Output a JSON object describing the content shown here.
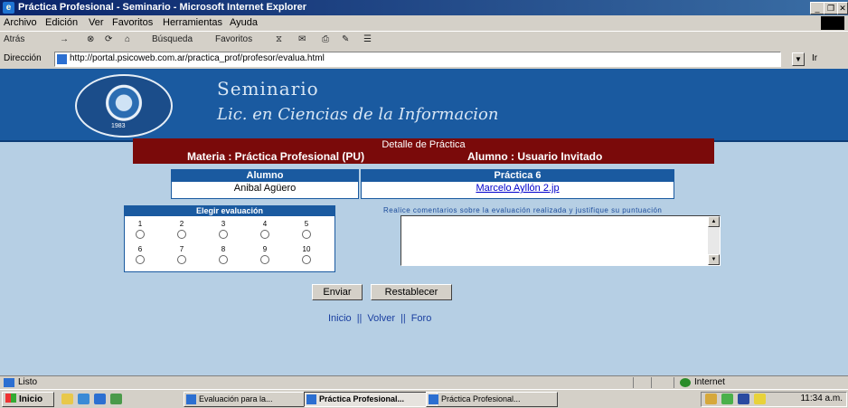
{
  "window": {
    "title": "Práctica Profesional - Seminario - Microsoft Internet Explorer",
    "buttons": [
      "_",
      "❐",
      "✕"
    ]
  },
  "menu": [
    "Archivo",
    "Edición",
    "Ver",
    "Favoritos",
    "Herramientas",
    "Ayuda"
  ],
  "toolbar": {
    "back": "Atrás",
    "forward": "→",
    "stop": "⊗",
    "refresh": "⟳",
    "home": "⌂",
    "search": "Búsqueda",
    "favorites": "Favoritos",
    "history": "⧖",
    "mail": "✉",
    "print": "⎙",
    "edit": "✎",
    "discuss": "☰"
  },
  "address": {
    "label": "Dirección",
    "url": "http://portal.psicoweb.com.ar/practica_prof/profesor/evalua.html",
    "go": "Ir"
  },
  "banner": {
    "line1": "Seminario",
    "line2": "Lic. en Ciencias de la Informacion",
    "seal_text": "1983"
  },
  "header": {
    "title": "Detalle de Práctica",
    "materia": "Materia : Práctica Profesional (PU)",
    "alumno": "Alumno : Usuario Invitado"
  },
  "info": {
    "alumno_header": "Alumno",
    "alumno_value": "Anibal Agüero",
    "practica_header": "Práctica 6",
    "practica_value": "Marcelo Ayllón 2.jp"
  },
  "evaluation": {
    "header": "Elegir evaluación",
    "options": [
      "1",
      "2",
      "3",
      "4",
      "5",
      "6",
      "7",
      "8",
      "9",
      "10"
    ]
  },
  "comment": {
    "label": "Realice comentarios sobre la evaluación realizada y justifique su puntuación"
  },
  "buttons": {
    "submit": "Enviar",
    "reset": "Restablecer"
  },
  "links": {
    "inicio": "Inicio",
    "volver": "Volver",
    "foro": "Foro",
    "separator": "||"
  },
  "status": {
    "text": "Listo",
    "zone": "Internet"
  },
  "taskbar": {
    "start": "Inicio",
    "tasks": [
      "Evaluación para la...",
      "Práctica Profesional...",
      "Práctica Profesional..."
    ],
    "clock": "11:34 a.m."
  }
}
